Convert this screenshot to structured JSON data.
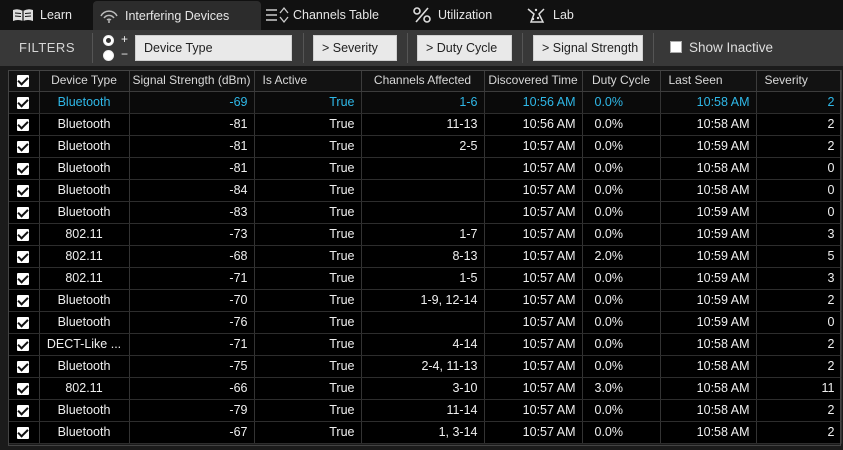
{
  "tabs": [
    {
      "label": "Learn",
      "icon": "book-icon"
    },
    {
      "label": "Interfering Devices",
      "icon": "wifi-signal-icon",
      "active": true
    },
    {
      "label": "Channels Table",
      "icon": "list-sort-icon"
    },
    {
      "label": "Utilization",
      "icon": "percent-icon"
    },
    {
      "label": "Lab",
      "icon": "lab-flask-icon"
    }
  ],
  "filters": {
    "label": "FILTERS",
    "plus": "+",
    "minus": "−",
    "device_type": "Device Type",
    "severity": "> Severity",
    "duty_cycle": "> Duty Cycle",
    "signal_strength": "> Signal Strength",
    "show_inactive": "Show Inactive"
  },
  "columns": [
    "Device Type",
    "Signal Strength (dBm)",
    "Is Active",
    "Channels Affected",
    "Discovered Time",
    "Duty Cycle",
    "Last Seen",
    "Severity"
  ],
  "rows": [
    {
      "device": "Bluetooth",
      "signal": "-69",
      "active": "True",
      "channels": "1-6",
      "discovered": "10:56 AM",
      "duty": "0.0%",
      "last_seen": "10:58 AM",
      "severity": "2",
      "selected": true
    },
    {
      "device": "Bluetooth",
      "signal": "-81",
      "active": "True",
      "channels": "11-13",
      "discovered": "10:56 AM",
      "duty": "0.0%",
      "last_seen": "10:58 AM",
      "severity": "2"
    },
    {
      "device": "Bluetooth",
      "signal": "-81",
      "active": "True",
      "channels": "2-5",
      "discovered": "10:57 AM",
      "duty": "0.0%",
      "last_seen": "10:59 AM",
      "severity": "2"
    },
    {
      "device": "Bluetooth",
      "signal": "-81",
      "active": "True",
      "channels": "",
      "discovered": "10:57 AM",
      "duty": "0.0%",
      "last_seen": "10:58 AM",
      "severity": "0"
    },
    {
      "device": "Bluetooth",
      "signal": "-84",
      "active": "True",
      "channels": "",
      "discovered": "10:57 AM",
      "duty": "0.0%",
      "last_seen": "10:58 AM",
      "severity": "0"
    },
    {
      "device": "Bluetooth",
      "signal": "-83",
      "active": "True",
      "channels": "",
      "discovered": "10:57 AM",
      "duty": "0.0%",
      "last_seen": "10:59 AM",
      "severity": "0"
    },
    {
      "device": "802.11",
      "signal": "-73",
      "active": "True",
      "channels": "1-7",
      "discovered": "10:57 AM",
      "duty": "0.0%",
      "last_seen": "10:59 AM",
      "severity": "3"
    },
    {
      "device": "802.11",
      "signal": "-68",
      "active": "True",
      "channels": "8-13",
      "discovered": "10:57 AM",
      "duty": "2.0%",
      "last_seen": "10:59 AM",
      "severity": "5"
    },
    {
      "device": "802.11",
      "signal": "-71",
      "active": "True",
      "channels": "1-5",
      "discovered": "10:57 AM",
      "duty": "0.0%",
      "last_seen": "10:59 AM",
      "severity": "3"
    },
    {
      "device": "Bluetooth",
      "signal": "-70",
      "active": "True",
      "channels": "1-9, 12-14",
      "discovered": "10:57 AM",
      "duty": "0.0%",
      "last_seen": "10:59 AM",
      "severity": "2"
    },
    {
      "device": "Bluetooth",
      "signal": "-76",
      "active": "True",
      "channels": "",
      "discovered": "10:57 AM",
      "duty": "0.0%",
      "last_seen": "10:59 AM",
      "severity": "0"
    },
    {
      "device": "DECT-Like ...",
      "signal": "-71",
      "active": "True",
      "channels": "4-14",
      "discovered": "10:57 AM",
      "duty": "0.0%",
      "last_seen": "10:58 AM",
      "severity": "2"
    },
    {
      "device": "Bluetooth",
      "signal": "-75",
      "active": "True",
      "channels": "2-4, 11-13",
      "discovered": "10:57 AM",
      "duty": "0.0%",
      "last_seen": "10:58 AM",
      "severity": "2"
    },
    {
      "device": "802.11",
      "signal": "-66",
      "active": "True",
      "channels": "3-10",
      "discovered": "10:57 AM",
      "duty": "3.0%",
      "last_seen": "10:58 AM",
      "severity": "11"
    },
    {
      "device": "Bluetooth",
      "signal": "-79",
      "active": "True",
      "channels": "11-14",
      "discovered": "10:57 AM",
      "duty": "0.0%",
      "last_seen": "10:58 AM",
      "severity": "2"
    },
    {
      "device": "Bluetooth",
      "signal": "-67",
      "active": "True",
      "channels": "1, 3-14",
      "discovered": "10:57 AM",
      "duty": "0.0%",
      "last_seen": "10:58 AM",
      "severity": "2"
    }
  ],
  "colors": {
    "selected_text": "#2fb8e8",
    "background": "#000000",
    "filter_bar": "#383838"
  }
}
